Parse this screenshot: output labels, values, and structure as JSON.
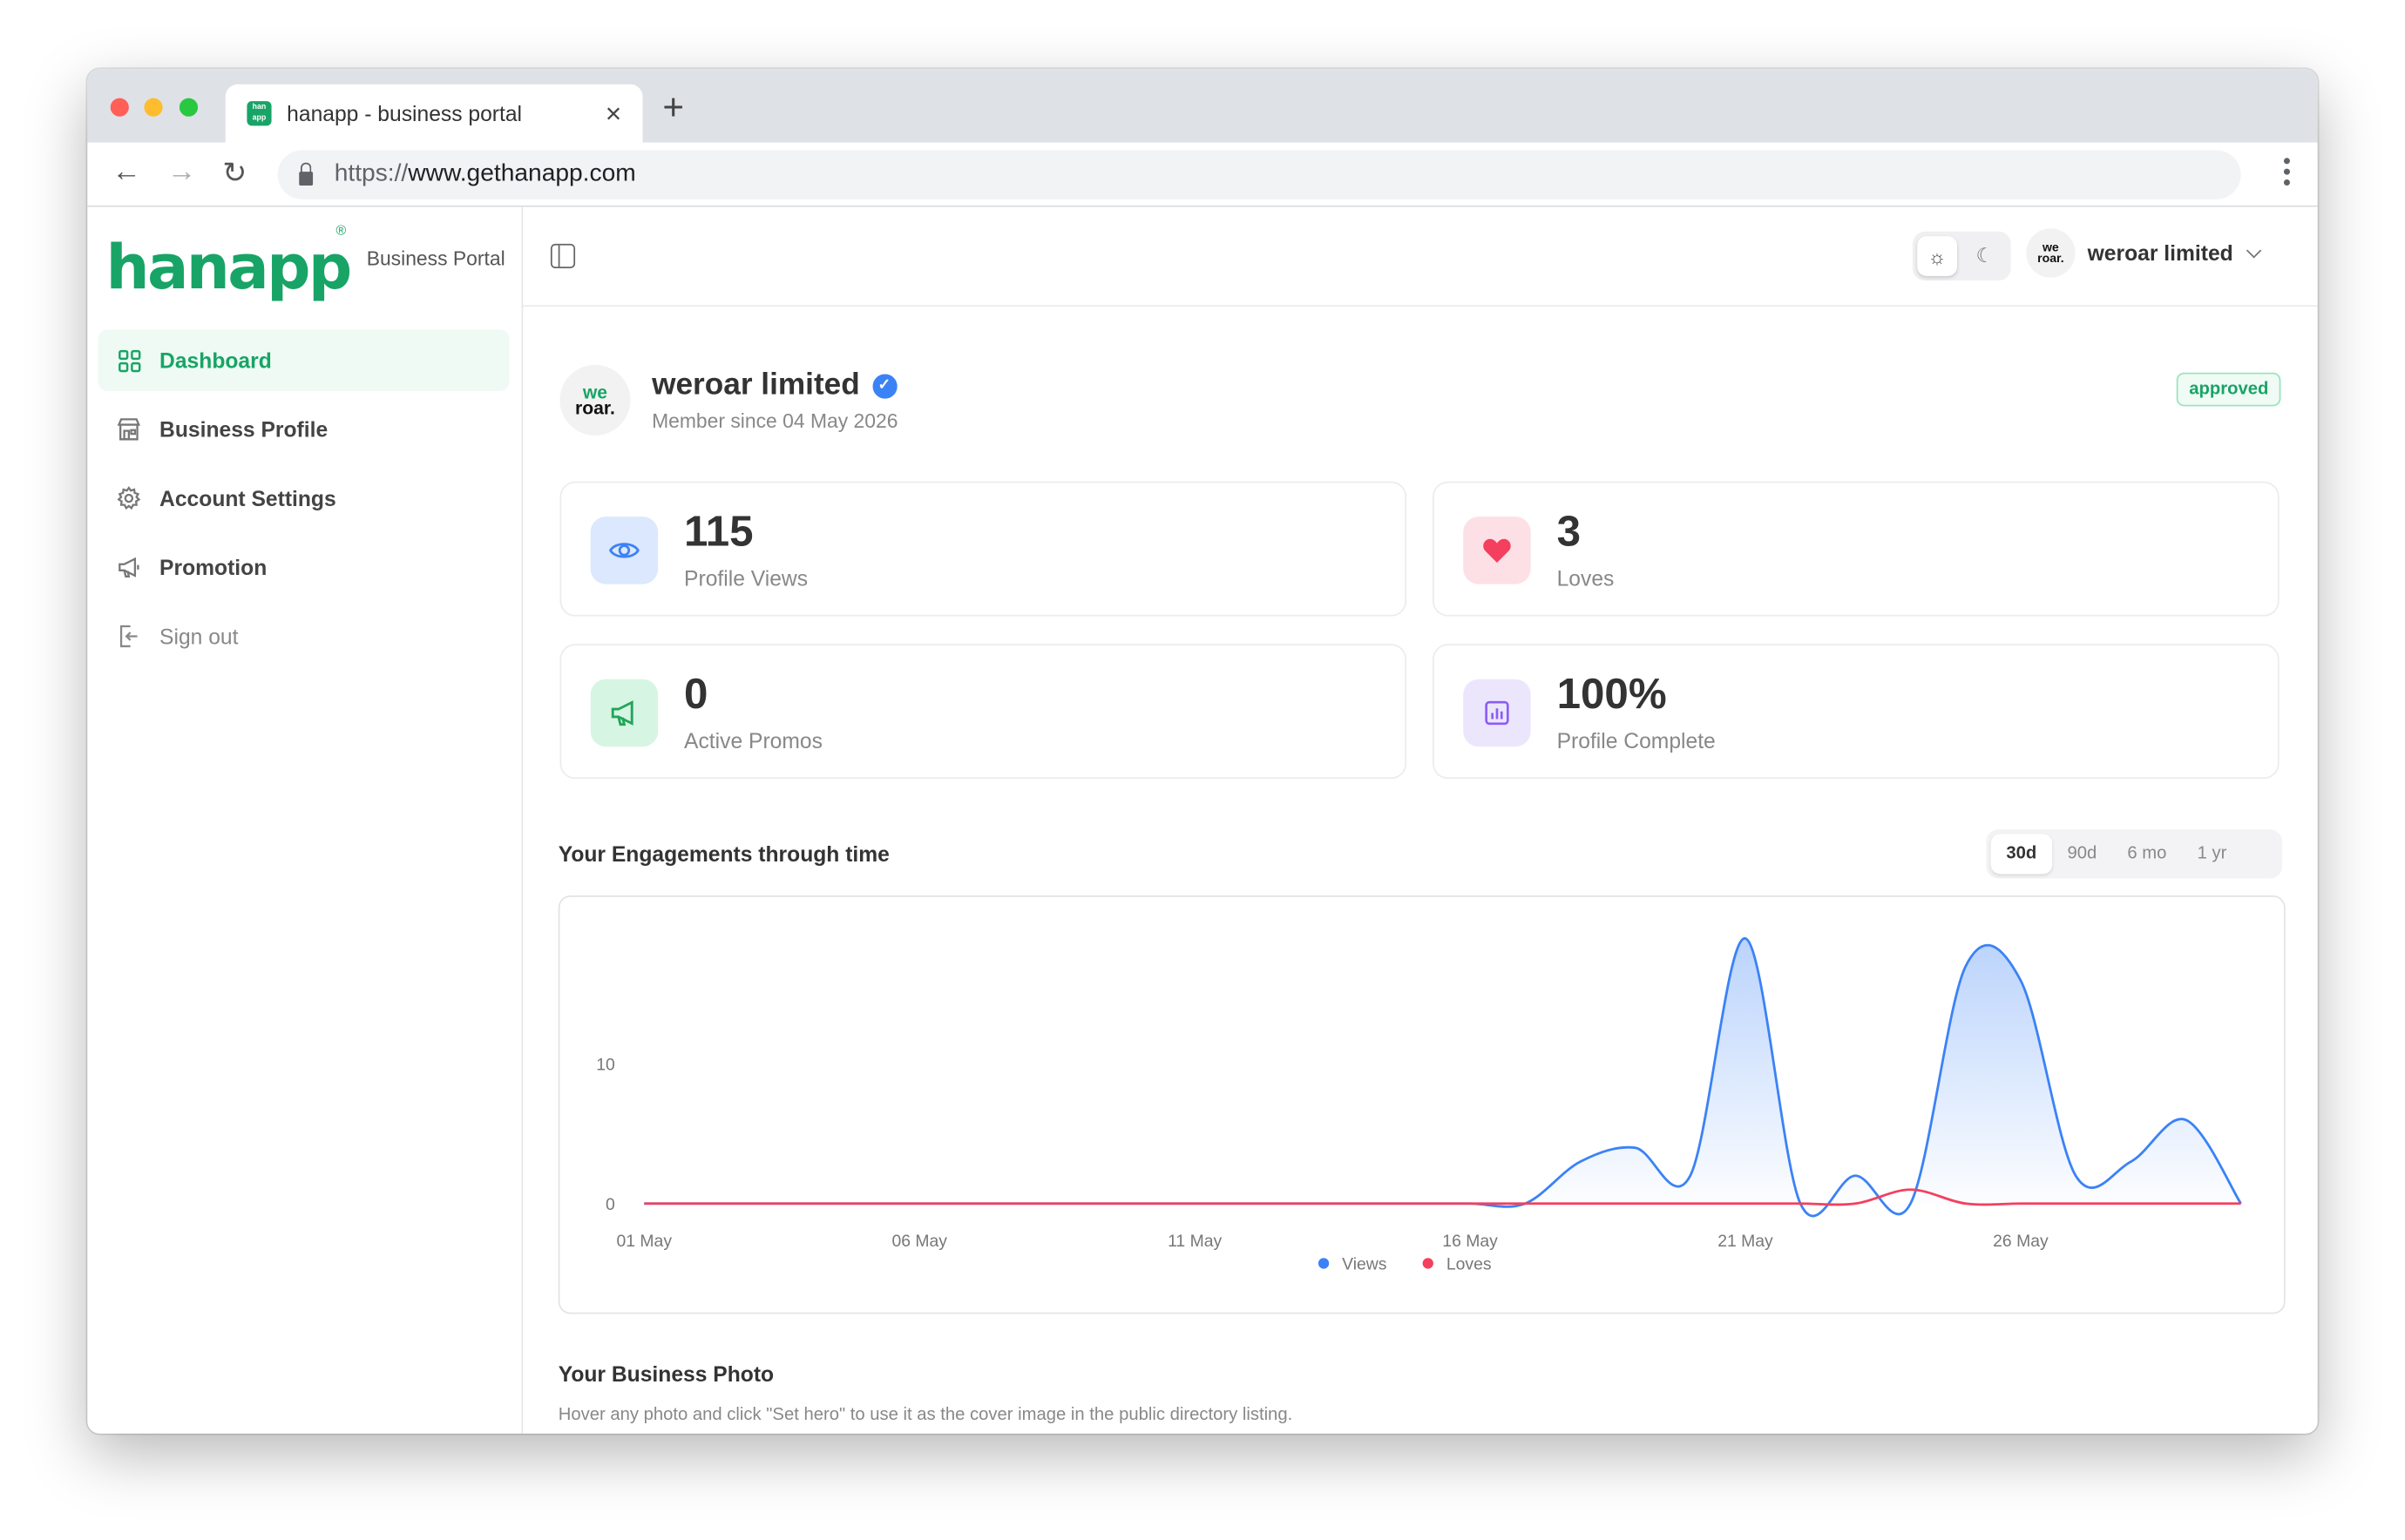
{
  "browser": {
    "tab_title": "hanapp - business portal",
    "url_scheme": "https://",
    "url_host": "www.gethanapp.com"
  },
  "sidebar": {
    "logo_text": "hanapp",
    "logo_mark": "®",
    "portal_label": "Business Portal",
    "items": [
      {
        "label": "Dashboard",
        "icon": "grid-icon"
      },
      {
        "label": "Business Profile",
        "icon": "storefront-icon"
      },
      {
        "label": "Account Settings",
        "icon": "gear-icon"
      },
      {
        "label": "Promotion",
        "icon": "megaphone-icon"
      },
      {
        "label": "Sign out",
        "icon": "sign-out-icon"
      }
    ]
  },
  "topbar": {
    "user_name": "weroar limited",
    "avatar_text_top": "we",
    "avatar_text_bottom": "roar."
  },
  "profile": {
    "name": "weroar limited",
    "member_since": "Member since 04 May 2026",
    "status": "approved"
  },
  "stats": [
    {
      "value": "115",
      "label": "Profile Views",
      "icon": "eye-icon",
      "color": "#3b82f6"
    },
    {
      "value": "3",
      "label": "Loves",
      "icon": "heart-icon",
      "color": "#f43f5e"
    },
    {
      "value": "0",
      "label": "Active Promos",
      "icon": "megaphone-icon",
      "color": "#22c55e"
    },
    {
      "value": "100%",
      "label": "Profile Complete",
      "icon": "bar-chart-icon",
      "color": "#8b5cf6"
    }
  ],
  "engagement": {
    "title": "Your Engagements through time",
    "ranges": [
      "30d",
      "90d",
      "6 mo",
      "1 yr"
    ],
    "selected_range": "30d"
  },
  "photo": {
    "title": "Your Business Photo",
    "help": "Hover any photo and click \"Set hero\" to use it as the cover image in the public directory listing."
  },
  "chart_data": {
    "type": "area",
    "x_tick_labels": [
      "01 May",
      "06 May",
      "11 May",
      "16 May",
      "21 May",
      "26 May"
    ],
    "y_tick_labels": [
      "0",
      "10"
    ],
    "ylim": [
      0,
      20
    ],
    "legend_placement": "bottom-center",
    "x": [
      "01 May",
      "02 May",
      "03 May",
      "04 May",
      "05 May",
      "06 May",
      "07 May",
      "08 May",
      "09 May",
      "10 May",
      "11 May",
      "12 May",
      "13 May",
      "14 May",
      "15 May",
      "16 May",
      "17 May",
      "18 May",
      "19 May",
      "20 May",
      "21 May",
      "22 May",
      "23 May",
      "24 May",
      "25 May",
      "26 May",
      "27 May",
      "28 May",
      "29 May",
      "30 May"
    ],
    "series": [
      {
        "name": "Views",
        "color": "#3b82f6",
        "values": [
          0,
          0,
          0,
          0,
          0,
          0,
          0,
          0,
          0,
          0,
          0,
          0,
          0,
          0,
          0,
          0,
          0,
          3,
          4,
          2,
          19,
          0,
          2,
          0,
          17,
          16,
          2,
          3,
          6,
          0
        ]
      },
      {
        "name": "Loves",
        "color": "#f43f5e",
        "values": [
          0,
          0,
          0,
          0,
          0,
          0,
          0,
          0,
          0,
          0,
          0,
          0,
          0,
          0,
          0,
          0,
          0,
          0,
          0,
          0,
          0,
          0,
          0,
          1,
          0,
          0,
          0,
          0,
          0,
          0
        ]
      }
    ]
  }
}
